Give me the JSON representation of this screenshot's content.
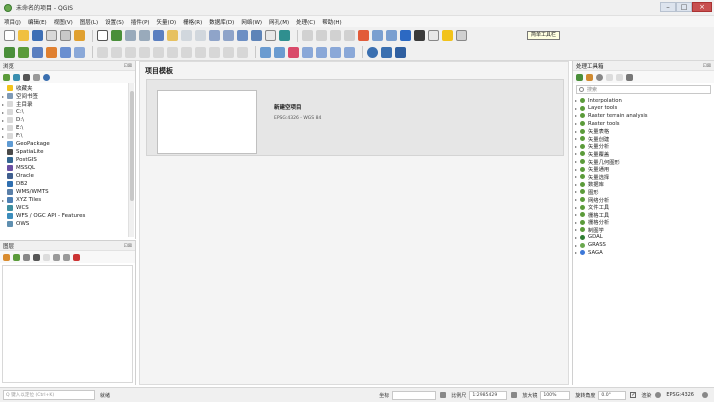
{
  "window": {
    "title": "未命名的项目 - QGIS",
    "controls": [
      "–",
      "□",
      "×"
    ]
  },
  "menu": [
    "项目(J)",
    "编辑(E)",
    "视图(V)",
    "图层(L)",
    "设置(S)",
    "插件(P)",
    "矢量(O)",
    "栅格(R)",
    "数据库(D)",
    "网络(W)",
    "网孔(M)",
    "处理(C)",
    "帮助(H)"
  ],
  "tooltip": "简单工具栏",
  "browser": {
    "title": "浏览",
    "items": [
      {
        "label": "收藏夹",
        "icon": "star-icon",
        "expand": "",
        "color": "#f2c31a"
      },
      {
        "label": "空间书签",
        "icon": "bookmark-icon",
        "expand": "▸",
        "color": "#7f9ab6"
      },
      {
        "label": "主目录",
        "icon": "home-folder-icon",
        "expand": "▸",
        "color": "#d9d9d9"
      },
      {
        "label": "C:\\",
        "icon": "drive-icon",
        "expand": "▸",
        "color": "#d9d9d9"
      },
      {
        "label": "D:\\",
        "icon": "drive-icon",
        "expand": "▸",
        "color": "#d9d9d9"
      },
      {
        "label": "E:\\",
        "icon": "drive-icon",
        "expand": "▸",
        "color": "#d9d9d9"
      },
      {
        "label": "F:\\",
        "icon": "drive-icon",
        "expand": "▸",
        "color": "#d9d9d9"
      },
      {
        "label": "GeoPackage",
        "icon": "geopackage-icon",
        "expand": "",
        "color": "#5f9bd3"
      },
      {
        "label": "SpatiaLite",
        "icon": "spatialite-icon",
        "expand": "",
        "color": "#4a4a4a"
      },
      {
        "label": "PostGIS",
        "icon": "postgis-icon",
        "expand": "",
        "color": "#336791"
      },
      {
        "label": "MSSQL",
        "icon": "mssql-icon",
        "expand": "",
        "color": "#6a4fa3"
      },
      {
        "label": "Oracle",
        "icon": "oracle-icon",
        "expand": "",
        "color": "#3f5f8f"
      },
      {
        "label": "DB2",
        "icon": "db2-icon",
        "expand": "",
        "color": "#2f6fb0"
      },
      {
        "label": "WMS/WMTS",
        "icon": "wms-icon",
        "expand": "",
        "color": "#5a7fa8"
      },
      {
        "label": "XYZ Tiles",
        "icon": "xyz-tiles-icon",
        "expand": "▸",
        "color": "#4d7fb3"
      },
      {
        "label": "WCS",
        "icon": "wcs-icon",
        "expand": "",
        "color": "#3f8fa0"
      },
      {
        "label": "WFS / OGC API - Features",
        "icon": "wfs-icon",
        "expand": "",
        "color": "#3c8dbc"
      },
      {
        "label": "OWS",
        "icon": "ows-icon",
        "expand": "",
        "color": "#5f8fb0"
      }
    ]
  },
  "layers": {
    "title": "图层"
  },
  "project": {
    "title": "项目模板",
    "new_project": "新建空项目",
    "crs": "EPSG:4326 - WGS 84"
  },
  "processing": {
    "title": "处理工具箱",
    "search_placeholder": "搜索",
    "items": [
      {
        "label": "Interpolation",
        "icon": "qgis-algorithm-icon",
        "color": "#5b9b3a"
      },
      {
        "label": "Layer tools",
        "icon": "qgis-algorithm-icon",
        "color": "#5b9b3a"
      },
      {
        "label": "Raster terrain analysis",
        "icon": "qgis-algorithm-icon",
        "color": "#5b9b3a"
      },
      {
        "label": "Raster tools",
        "icon": "qgis-algorithm-icon",
        "color": "#5b9b3a"
      },
      {
        "label": "矢量表格",
        "icon": "qgis-algorithm-icon",
        "color": "#5b9b3a"
      },
      {
        "label": "矢量创建",
        "icon": "qgis-algorithm-icon",
        "color": "#5b9b3a"
      },
      {
        "label": "矢量分析",
        "icon": "qgis-algorithm-icon",
        "color": "#5b9b3a"
      },
      {
        "label": "矢量覆盖",
        "icon": "qgis-algorithm-icon",
        "color": "#5b9b3a"
      },
      {
        "label": "矢量几何图形",
        "icon": "qgis-algorithm-icon",
        "color": "#5b9b3a"
      },
      {
        "label": "矢量通用",
        "icon": "qgis-algorithm-icon",
        "color": "#5b9b3a"
      },
      {
        "label": "矢量选择",
        "icon": "qgis-algorithm-icon",
        "color": "#5b9b3a"
      },
      {
        "label": "数据库",
        "icon": "qgis-algorithm-icon",
        "color": "#5b9b3a"
      },
      {
        "label": "图形",
        "icon": "qgis-algorithm-icon",
        "color": "#5b9b3a"
      },
      {
        "label": "网络分析",
        "icon": "qgis-algorithm-icon",
        "color": "#5b9b3a"
      },
      {
        "label": "文件工具",
        "icon": "qgis-algorithm-icon",
        "color": "#5b9b3a"
      },
      {
        "label": "栅格工具",
        "icon": "qgis-algorithm-icon",
        "color": "#5b9b3a"
      },
      {
        "label": "栅格分析",
        "icon": "qgis-algorithm-icon",
        "color": "#5b9b3a"
      },
      {
        "label": "制图学",
        "icon": "qgis-algorithm-icon",
        "color": "#5b9b3a"
      },
      {
        "label": "GDAL",
        "icon": "gdal-icon",
        "color": "#2e7d32"
      },
      {
        "label": "GRASS",
        "icon": "grass-icon",
        "color": "#6aa84f"
      },
      {
        "label": "SAGA",
        "icon": "saga-icon",
        "color": "#3c78d8"
      }
    ]
  },
  "statusbar": {
    "locator_placeholder": "Q 键入以定位 (Ctrl+K)",
    "ready": "就绪",
    "coordinate_label": "坐标",
    "scale_label": "比例尺",
    "scale_value": "1:2985429",
    "magnifier_label": "放大镜",
    "magnifier_value": "100%",
    "rotation_label": "旋转角度",
    "rotation_value": "0.0°",
    "render_label": "渲染",
    "crs_value": "EPSG:4326"
  }
}
